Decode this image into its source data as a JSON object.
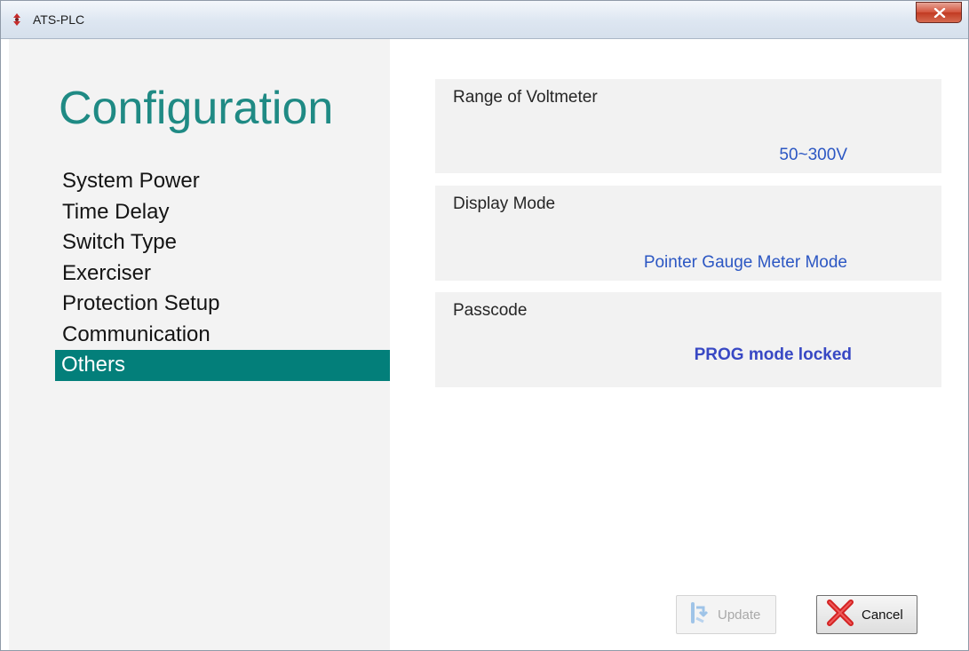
{
  "window": {
    "title": "ATS-PLC",
    "app_icon": "ats-plc-app-icon",
    "close_icon": "close-x-icon"
  },
  "sidebar": {
    "title": "Configuration",
    "items": [
      {
        "label": "System Power",
        "active": false
      },
      {
        "label": "Time Delay",
        "active": false
      },
      {
        "label": "Switch Type",
        "active": false
      },
      {
        "label": "Exerciser",
        "active": false
      },
      {
        "label": "Protection Setup",
        "active": false
      },
      {
        "label": "Communication",
        "active": false
      },
      {
        "label": "Others",
        "active": true
      }
    ]
  },
  "settings": {
    "voltmeter_range": {
      "label": "Range of Voltmeter",
      "value": "50~300V"
    },
    "display_mode": {
      "label": "Display Mode",
      "value": "Pointer Gauge Meter Mode"
    },
    "passcode": {
      "label": "Passcode",
      "value": "PROG mode locked"
    }
  },
  "buttons": {
    "update": {
      "label": "Update",
      "enabled": false,
      "icon": "update-icon"
    },
    "cancel": {
      "label": "Cancel",
      "enabled": true,
      "icon": "cancel-x-icon"
    }
  },
  "colors": {
    "accent": "#037f7a",
    "title_teal": "#1f8a84",
    "value_blue": "#2c57c3"
  }
}
